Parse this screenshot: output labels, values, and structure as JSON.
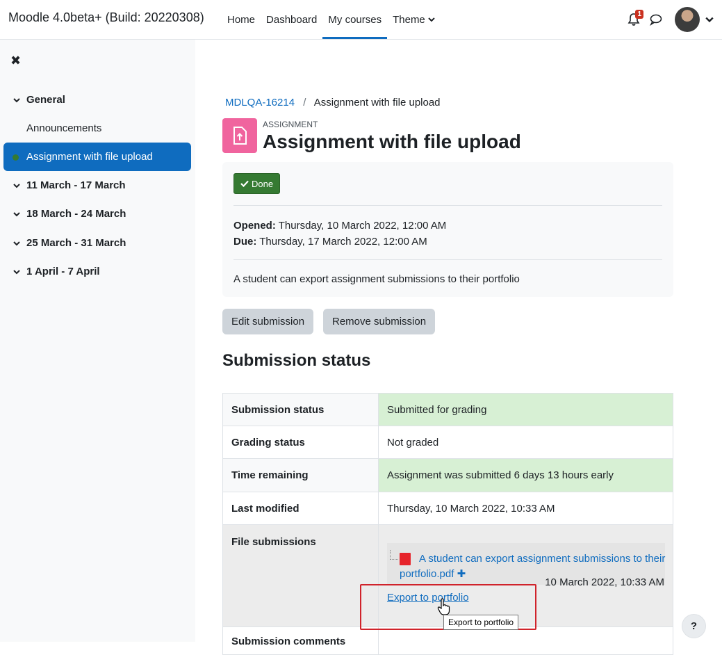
{
  "navbar": {
    "brand": "Moodle 4.0beta+ (Build: 20220308)",
    "items": [
      {
        "label": "Home"
      },
      {
        "label": "Dashboard"
      },
      {
        "label": "My courses",
        "active": true
      },
      {
        "label": "Theme"
      }
    ],
    "notification_count": "1"
  },
  "sidebar": {
    "close": "✖",
    "sections": [
      {
        "label": "General"
      },
      {
        "label": "11 March - 17 March"
      },
      {
        "label": "18 March - 24 March"
      },
      {
        "label": "25 March - 31 March"
      },
      {
        "label": "1 April - 7 April"
      }
    ],
    "items": [
      {
        "label": "Announcements"
      },
      {
        "label": "Assignment with file upload"
      }
    ]
  },
  "breadcrumb": {
    "course": "MDLQA-16214",
    "separator": "/",
    "current": "Assignment with file upload"
  },
  "header": {
    "type": "ASSIGNMENT",
    "title": "Assignment with file upload"
  },
  "info": {
    "done_label": "Done",
    "opened_label": "Opened:",
    "opened_value": "Thursday, 10 March 2022, 12:00 AM",
    "due_label": "Due:",
    "due_value": "Thursday, 17 March 2022, 12:00 AM",
    "description": "A student can export assignment submissions to their portfolio"
  },
  "buttons": {
    "edit": "Edit submission",
    "remove": "Remove submission"
  },
  "submission": {
    "heading": "Submission status",
    "rows": [
      {
        "label": "Submission status",
        "value": "Submitted for grading"
      },
      {
        "label": "Grading status",
        "value": "Not graded"
      },
      {
        "label": "Time remaining",
        "value": "Assignment was submitted 6 days 13 hours early"
      },
      {
        "label": "Last modified",
        "value": "Thursday, 10 March 2022, 10:33 AM"
      }
    ],
    "files_label": "File submissions",
    "file_name": "A student can export assignment submissions to their portfolio.pdf",
    "file_date": "10 March 2022, 10:33 AM",
    "export_link": "Export to portfolio",
    "tooltip": "Export to portfolio",
    "next_label": "Submission comments"
  },
  "help": "?",
  "colors": {
    "accent": "#0f6cbf",
    "success": "#357a32",
    "assignment_icon": "#f0649e",
    "status_ok": "#d7f0d4",
    "highlight": "#d0232b"
  }
}
